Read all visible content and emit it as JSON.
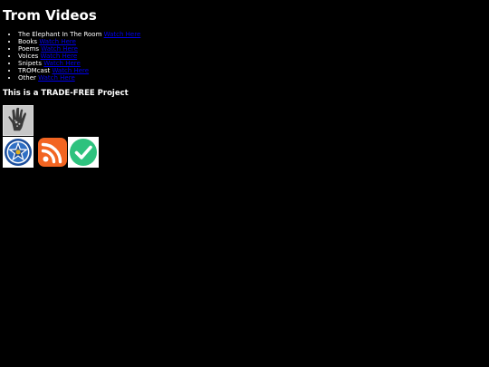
{
  "page": {
    "title": "Trom Videos",
    "subtitle": "This is a TRADE-FREE Project"
  },
  "videos": [
    {
      "label": "The Elephant In The Room",
      "link_text": "Watch Here"
    },
    {
      "label": "Books",
      "link_text": "Watch Here"
    },
    {
      "label": "Poems",
      "link_text": "Watch Here"
    },
    {
      "label": "Voices",
      "link_text": "Watch Here"
    },
    {
      "label": "Snipets",
      "link_text": "Watch Here"
    },
    {
      "label": "TROMcast",
      "link_text": "Watch Here"
    },
    {
      "label": "Other",
      "link_text": "Watch Here"
    }
  ],
  "badges": [
    {
      "icon": "trade-free-hand-icon"
    },
    {
      "icon": "star-emblem-icon"
    },
    {
      "icon": "rss-feed-icon"
    },
    {
      "icon": "green-checkmark-icon"
    }
  ],
  "colors": {
    "background": "#000000",
    "text": "#ffffff",
    "link": "#0000ee",
    "rss_orange": "#f26522",
    "check_green": "#2ec27e",
    "emblem_blue": "#1c4e9c"
  }
}
